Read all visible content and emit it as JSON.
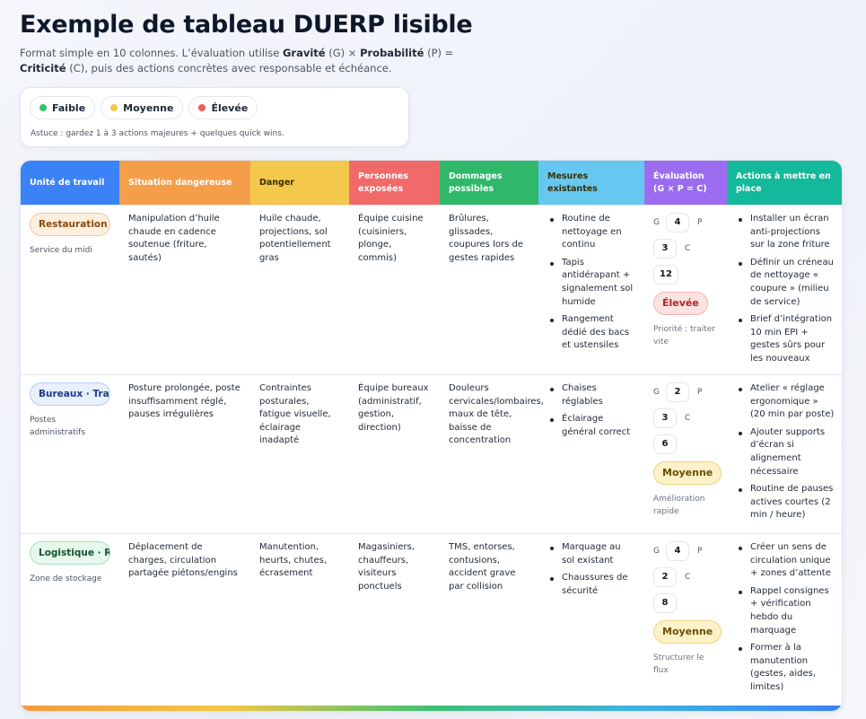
{
  "header": {
    "title": "Exemple de tableau DUERP lisible",
    "subtitle_parts": {
      "p1": "Format simple en 10 colonnes. L’évaluation utilise ",
      "b1": "Gravité",
      "p2": " (G) × ",
      "b2": "Probabilité",
      "p3": " (P) = ",
      "b3": "Criticité",
      "p4": " (C), puis des actions concrètes avec responsable et échéance."
    }
  },
  "legend": {
    "items": [
      {
        "label": "Faible",
        "color": "#36c26a"
      },
      {
        "label": "Moyenne",
        "color": "#f3c84b"
      },
      {
        "label": "Élevée",
        "color": "#ef5a5a"
      }
    ],
    "tip": "Astuce : gardez 1 à 3 actions majeures + quelques quick wins."
  },
  "table": {
    "columns": [
      {
        "label": "Unité de travail",
        "color": "#3b82f6"
      },
      {
        "label": "Situation dangereuse",
        "color": "#f59e4a"
      },
      {
        "label": "Danger",
        "color": "#f4c84a"
      },
      {
        "label": "Personnes exposées",
        "color": "#f06a6a"
      },
      {
        "label": "Dommages possibles",
        "color": "#2fb86a"
      },
      {
        "label": "Mesures existantes",
        "color": "#66c8f0"
      },
      {
        "label": "Évaluation (G × P = C)",
        "color": "#9b6cf0"
      },
      {
        "label": "Actions à mettre en place",
        "color": "#14b89a"
      }
    ],
    "rows": [
      {
        "unit": "Restauration · Cuisine",
        "unit_sub": "Service du midi",
        "situation": "Manipulation d’huile chaude en cadence soutenue (friture, sautés)",
        "danger": "Huile chaude, projections, sol potentiellement gras",
        "personnes": "Équipe cuisine (cuisiniers, plonge, commis)",
        "dommages": "Brûlures, glissades, coupures lors de gestes rapides",
        "mesures": [
          "Routine de nettoyage en continu",
          "Tapis antidérapant + signalement sol humide",
          "Rangement dédié des bacs et ustensiles"
        ],
        "eval": {
          "g": "4",
          "p": "3",
          "c": "12",
          "level": "Élevée",
          "note": "Priorité : traiter vite"
        },
        "actions": [
          "Installer un écran anti-projections sur la zone friture",
          "Définir un créneau de nettoyage « coupure » (milieu de service)",
          "Brief d’intégration 10 min EPI + gestes sûrs pour les nouveaux"
        ]
      },
      {
        "unit": "Bureaux · Travail sur écran",
        "unit_sub": "Postes administratifs",
        "situation": "Posture prolongée, poste insuffisamment réglé, pauses irrégulières",
        "danger": "Contraintes posturales, fatigue visuelle, éclairage inadapté",
        "personnes": "Équipe bureaux (administratif, gestion, direction)",
        "dommages": "Douleurs cervicales/lombaires, maux de tête, baisse de concentration",
        "mesures": [
          "Chaises réglables",
          "Éclairage général correct"
        ],
        "eval": {
          "g": "2",
          "p": "3",
          "c": "6",
          "level": "Moyenne",
          "note": "Amélioration rapide"
        },
        "actions": [
          "Atelier « réglage ergonomique » (20 min par poste)",
          "Ajouter supports d’écran si alignement nécessaire",
          "Routine de pauses actives courtes (2 min / heure)"
        ]
      },
      {
        "unit": "Logistique · Réception",
        "unit_sub": "Zone de stockage",
        "situation": "Déplacement de charges, circulation partagée piétons/engins",
        "danger": "Manutention, heurts, chutes, écrasement",
        "personnes": "Magasiniers, chauffeurs, visiteurs ponctuels",
        "dommages": "TMS, entorses, contusions, accident grave par collision",
        "mesures": [
          "Marquage au sol existant",
          "Chaussures de sécurité"
        ],
        "eval": {
          "g": "4",
          "p": "2",
          "c": "8",
          "level": "Moyenne",
          "note": "Structurer le flux"
        },
        "actions": [
          "Créer un sens de circulation unique + zones d’attente",
          "Rappel consignes + vérification hebdo du marquage",
          "Former à la manutention (gestes, aides, limites)"
        ]
      }
    ],
    "eval_labels": {
      "g": "G",
      "p": "P",
      "c": "C"
    }
  }
}
